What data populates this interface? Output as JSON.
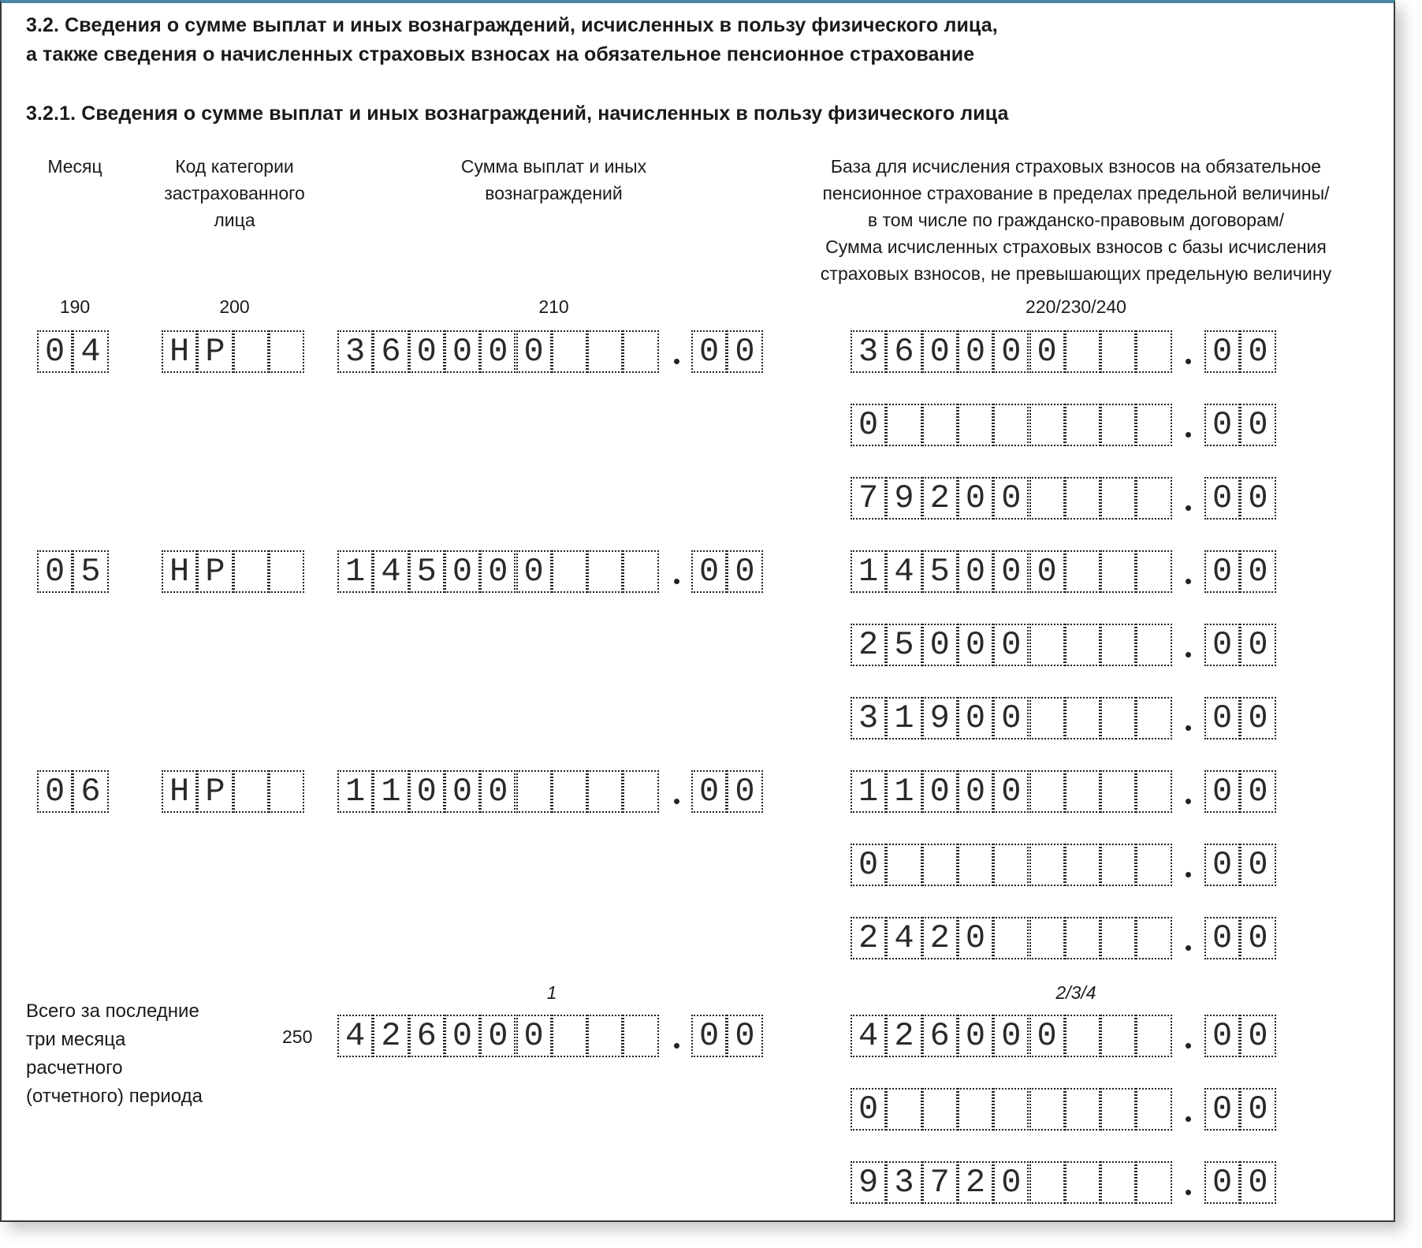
{
  "section": {
    "title_line1": "3.2. Сведения о сумме выплат и иных вознаграждений, исчисленных в пользу физического лица,",
    "title_line2": "а также сведения о начисленных страховых взносах на обязательное  пенсионное страхование",
    "subtitle": "3.2.1. Сведения о сумме выплат и иных вознаграждений, начисленных в пользу физического лица"
  },
  "columns": {
    "month": {
      "header": [
        "Месяц"
      ],
      "code": "190"
    },
    "category": {
      "header": [
        "Код категории",
        "застрахованного",
        "лица"
      ],
      "code": "200"
    },
    "amount": {
      "header": [
        "Сумма выплат и иных",
        "вознаграждений"
      ],
      "code": "210"
    },
    "base": {
      "header": [
        "База для исчисления страховых взносов на обязательное",
        "пенсионное страхование в пределах предельной величины/",
        "в том числе по гражданско-правовым договорам/",
        "Сумма исчисленных страховых взносов с базы исчисления",
        "страховых взносов, не превышающих предельную величину"
      ],
      "code": "220/230/240"
    }
  },
  "rows": [
    {
      "month": "04",
      "category": "НР",
      "amount": {
        "int": "360000",
        "dec": "00"
      },
      "base": [
        {
          "int": "360000",
          "dec": "00"
        },
        {
          "int": "0",
          "dec": "00"
        },
        {
          "int": "79200",
          "dec": "00"
        }
      ]
    },
    {
      "month": "05",
      "category": "НР",
      "amount": {
        "int": "145000",
        "dec": "00"
      },
      "base": [
        {
          "int": "145000",
          "dec": "00"
        },
        {
          "int": "25000",
          "dec": "00"
        },
        {
          "int": "31900",
          "dec": "00"
        }
      ]
    },
    {
      "month": "06",
      "category": "НР",
      "amount": {
        "int": "11000",
        "dec": "00"
      },
      "base": [
        {
          "int": "11000",
          "dec": "00"
        },
        {
          "int": "0",
          "dec": "00"
        },
        {
          "int": "2420",
          "dec": "00"
        }
      ]
    }
  ],
  "totals": {
    "label": [
      "Всего за последние",
      "три месяца",
      "расчетного",
      "(отчетного) периода"
    ],
    "line_code": "250",
    "amount_col_label": "1",
    "base_col_label": "2/3/4",
    "amount": {
      "int": "426000",
      "dec": "00"
    },
    "base": [
      {
        "int": "426000",
        "dec": "00"
      },
      {
        "int": "0",
        "dec": "00"
      },
      {
        "int": "93720",
        "dec": "00"
      }
    ]
  }
}
